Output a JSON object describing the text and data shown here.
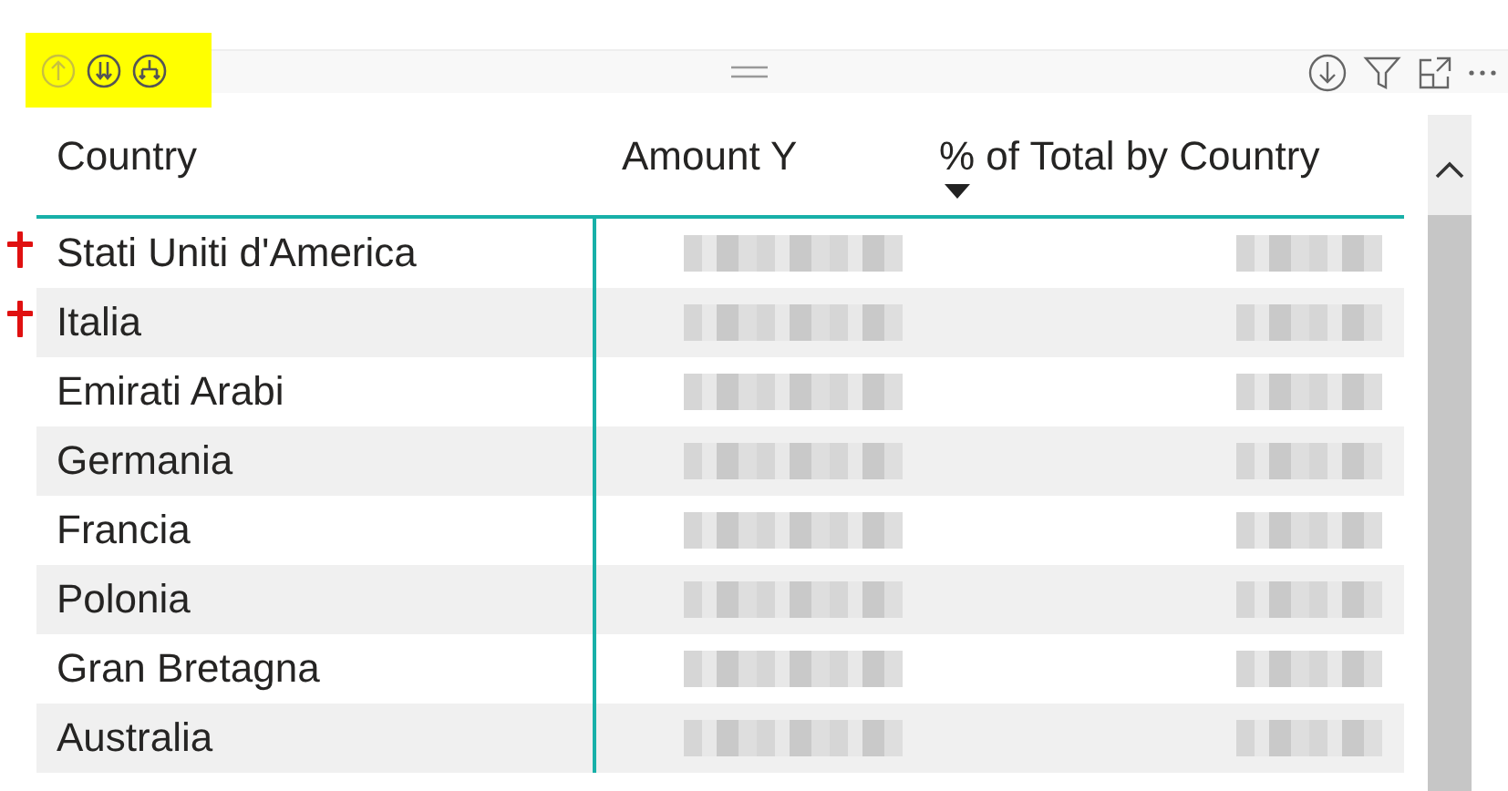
{
  "visual_header": {
    "highlighted": true
  },
  "table": {
    "columns": [
      {
        "label": "Country",
        "sorted": false
      },
      {
        "label": "Amount Y",
        "sorted": false
      },
      {
        "label": "% of Total by Country",
        "sorted": true
      }
    ],
    "rows": [
      {
        "country": "Stati Uniti d'America",
        "marked": true
      },
      {
        "country": "Italia",
        "marked": true
      },
      {
        "country": "Emirati Arabi",
        "marked": false
      },
      {
        "country": "Germania",
        "marked": false
      },
      {
        "country": "Francia",
        "marked": false
      },
      {
        "country": "Polonia",
        "marked": false
      },
      {
        "country": "Gran Bretagna",
        "marked": false
      },
      {
        "country": "Australia",
        "marked": false
      }
    ]
  }
}
